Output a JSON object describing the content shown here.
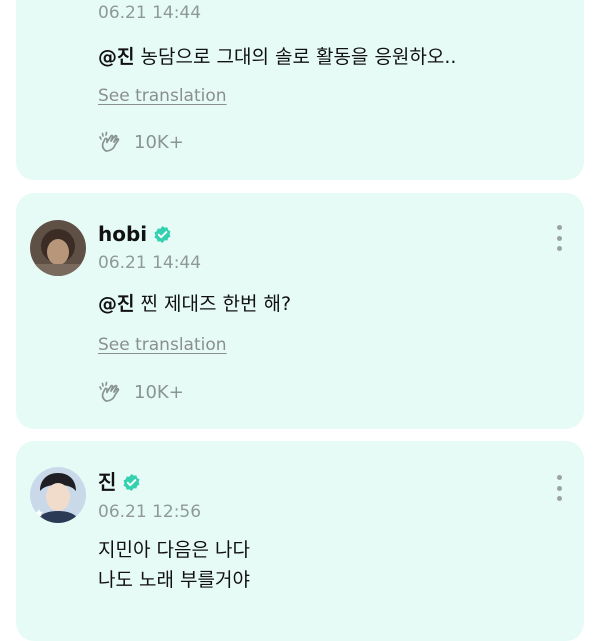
{
  "posts": [
    {
      "author": "",
      "time": "06.21 14:44",
      "mention": "@진",
      "text": " 농담으로 그대의 솔로 활동을 응원하오..",
      "translate_label": "See translation",
      "cheer_count": "10K+",
      "verified": true
    },
    {
      "author": "hobi",
      "time": "06.21 14:44",
      "mention": "@진",
      "text": " 찐 제대즈 한번 해?",
      "translate_label": "See translation",
      "cheer_count": "10K+",
      "verified": true
    },
    {
      "author": "진",
      "time": "06.21 12:56",
      "lines": [
        "지민아 다음은 나다",
        "나도 노래 부를거야"
      ],
      "verified": true
    }
  ],
  "colors": {
    "card_bg": "#e7fbf6",
    "verified": "#35d0b0",
    "muted": "#8f9a98"
  },
  "icons": {
    "verified": "verified-badge-icon",
    "more": "more-vertical-icon",
    "cheer": "clap-hands-icon"
  }
}
